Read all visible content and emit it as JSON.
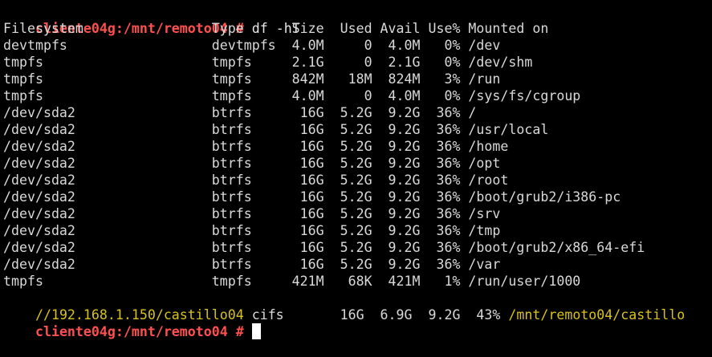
{
  "prompt": {
    "host_path": "cliente04g:/mnt/remoto04",
    "symbol": "#"
  },
  "command": "df -hT",
  "header": "Filesystem                Type      Size  Used Avail Use% Mounted on",
  "rows": [
    "devtmpfs                  devtmpfs  4.0M     0  4.0M   0% /dev",
    "tmpfs                     tmpfs     2.1G     0  2.1G   0% /dev/shm",
    "tmpfs                     tmpfs     842M   18M  824M   3% /run",
    "tmpfs                     tmpfs     4.0M     0  4.0M   0% /sys/fs/cgroup",
    "/dev/sda2                 btrfs      16G  5.2G  9.2G  36% /",
    "/dev/sda2                 btrfs      16G  5.2G  9.2G  36% /usr/local",
    "/dev/sda2                 btrfs      16G  5.2G  9.2G  36% /home",
    "/dev/sda2                 btrfs      16G  5.2G  9.2G  36% /opt",
    "/dev/sda2                 btrfs      16G  5.2G  9.2G  36% /root",
    "/dev/sda2                 btrfs      16G  5.2G  9.2G  36% /boot/grub2/i386-pc",
    "/dev/sda2                 btrfs      16G  5.2G  9.2G  36% /srv",
    "/dev/sda2                 btrfs      16G  5.2G  9.2G  36% /tmp",
    "/dev/sda2                 btrfs      16G  5.2G  9.2G  36% /boot/grub2/x86_64-efi",
    "/dev/sda2                 btrfs      16G  5.2G  9.2G  36% /var",
    "tmpfs                     tmpfs     421M   68K  421M   1% /run/user/1000"
  ],
  "cifs_row": {
    "filesystem": "//192.168.1.150/castillo04",
    "middle": " cifs       16G  6.9G  9.2G  43% ",
    "mount": "/mnt/remoto04/castillo"
  },
  "colors": {
    "background": "#000000",
    "text": "#d9d9d9",
    "prompt": "#ff4f4f",
    "highlight": "#d8c21b",
    "cursor": "#ffffff"
  }
}
